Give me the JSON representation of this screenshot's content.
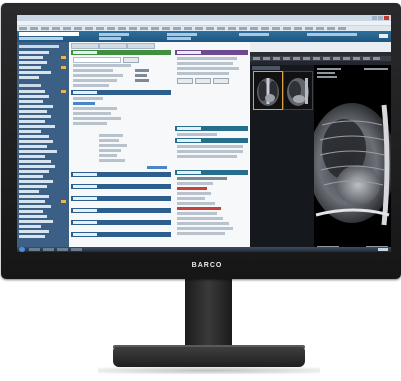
{
  "monitor": {
    "brand": "BARCO",
    "bezel_color": "#1f1f21",
    "stand_color": "#2b2b2c"
  },
  "app": {
    "accent_color": "#1e5680",
    "nav_color": "#3c5f86",
    "window_controls": [
      "minimize",
      "maximize",
      "close"
    ]
  },
  "nav": {
    "sections": 2,
    "badge_color": "#f0b445"
  },
  "panels": [
    {
      "position": "left-top",
      "color": "#3f8f3f"
    },
    {
      "position": "left-middle",
      "color": "#2d5f8e"
    },
    {
      "position": "left-lower",
      "color": "#2d5f8e"
    },
    {
      "position": "right-top",
      "color": "#6e4a8f"
    },
    {
      "position": "right-middle",
      "color": "#276e8c"
    },
    {
      "position": "right-lower",
      "color": "#276e8c"
    }
  ],
  "alerts": {
    "color": "#c9413a"
  },
  "viewer": {
    "thumbnails": [
      {
        "view": "chest-xray-frontal",
        "selected": true
      },
      {
        "view": "chest-xray-lateral",
        "selected": false
      }
    ],
    "main_image": "chest-xray-lateral",
    "selection_color": "#d9a441"
  },
  "icons": [
    "windows-start-icon",
    "minimize-icon",
    "maximize-icon",
    "close-icon"
  ]
}
